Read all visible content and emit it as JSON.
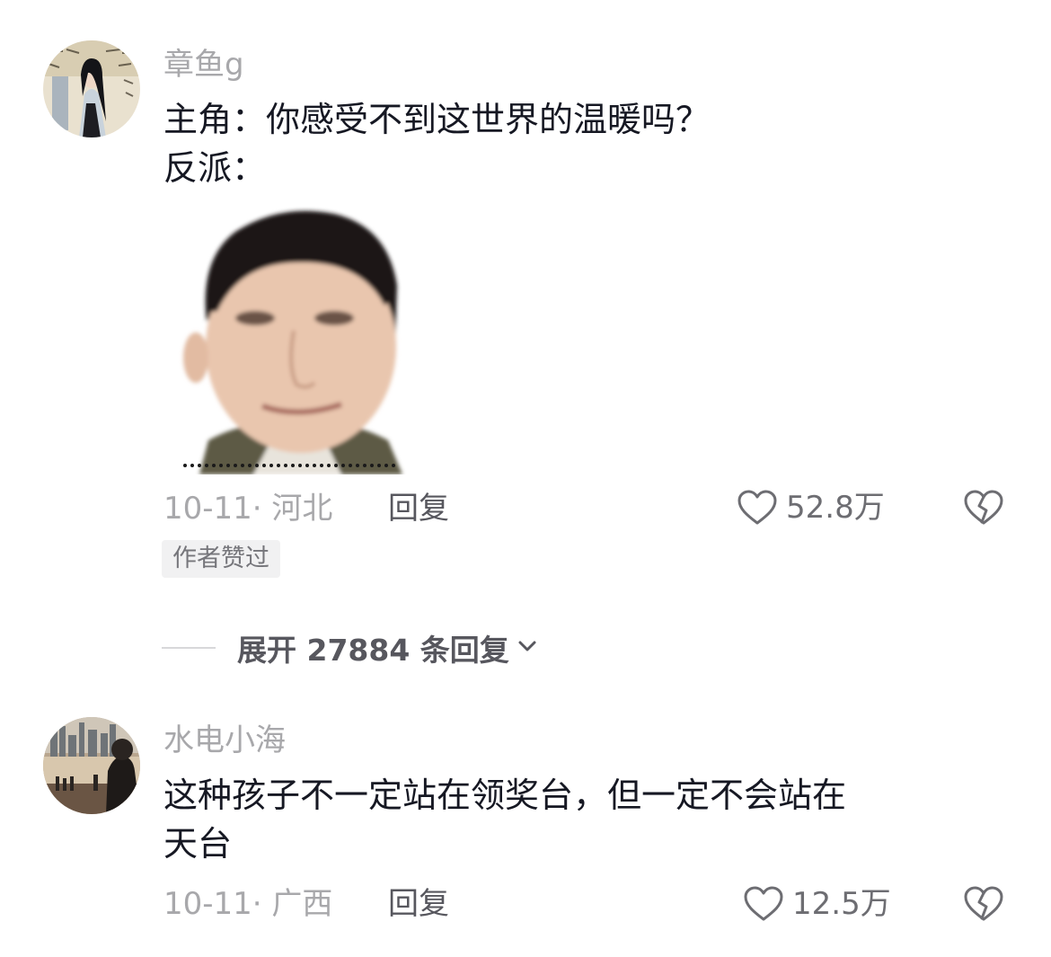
{
  "comments": [
    {
      "username": "章鱼g",
      "text_lines": [
        "主角：你感受不到这世界的温暖吗？",
        "反派："
      ],
      "date_location": "10-11· 河北",
      "reply_label": "回复",
      "likes": "52.8万",
      "badge": "作者赞过",
      "expand_replies": "展开 27884 条回复"
    },
    {
      "username": "水电小海",
      "text_lines": [
        "这种孩子不一定站在领奖台，但一定不会站在",
        "天台"
      ],
      "date_location": "10-11· 广西",
      "reply_label": "回复",
      "likes": "12.5万"
    }
  ],
  "icons": {
    "like": "heart-outline-icon",
    "dislike": "broken-heart-icon",
    "expand": "chevron-down-icon"
  },
  "colors": {
    "text_primary": "#161823",
    "text_secondary": "#a8a8ab",
    "badge_bg": "#f1f1f2"
  }
}
